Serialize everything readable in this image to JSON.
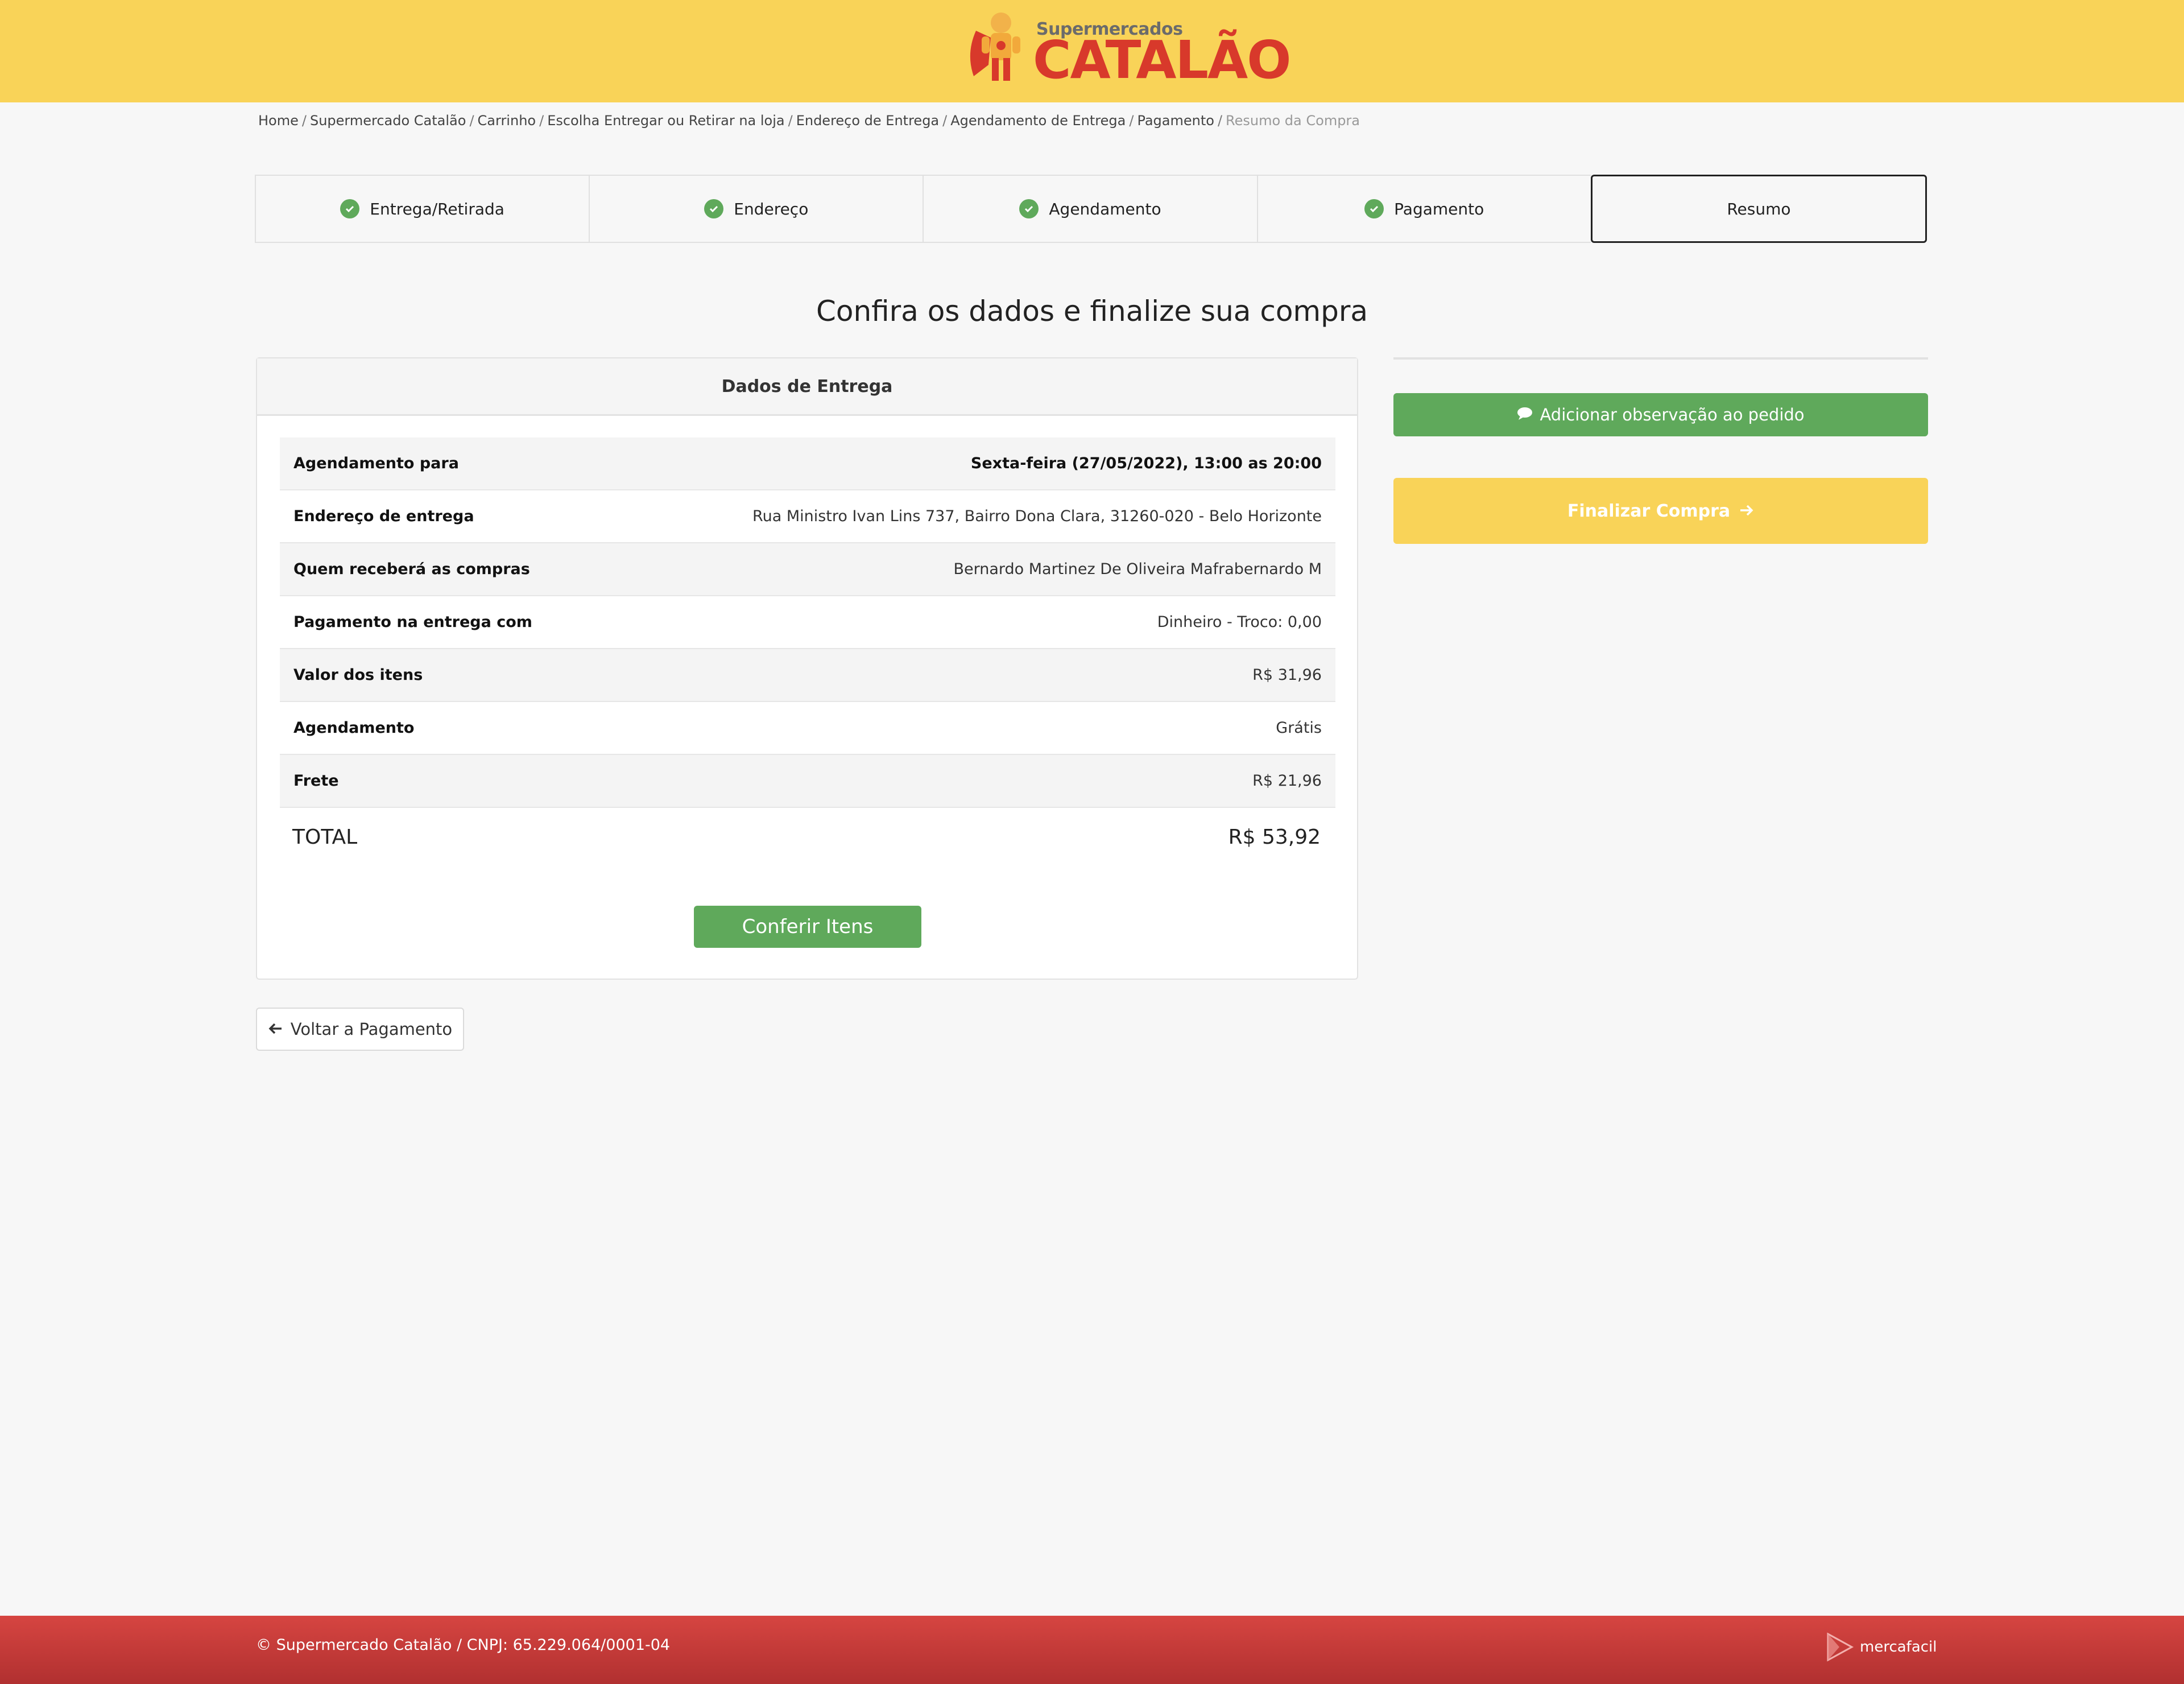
{
  "header": {
    "logo_subtitle": "Supermercados",
    "logo_title": "CATALÃO"
  },
  "breadcrumb": {
    "items": [
      "Home",
      "Supermercado Catalão",
      "Carrinho",
      "Escolha Entregar ou Retirar na loja",
      "Endereço de Entrega",
      "Agendamento de Entrega",
      "Pagamento"
    ],
    "current": "Resumo da Compra"
  },
  "steps": [
    {
      "label": "Entrega/Retirada",
      "done": true
    },
    {
      "label": "Endereço",
      "done": true
    },
    {
      "label": "Agendamento",
      "done": true
    },
    {
      "label": "Pagamento",
      "done": true
    },
    {
      "label": "Resumo",
      "done": false,
      "active": true
    }
  ],
  "page_title": "Confira os dados e finalize sua compra",
  "delivery": {
    "title": "Dados de Entrega",
    "rows": [
      {
        "label": "Agendamento para",
        "value": "Sexta-feira (27/05/2022), 13:00 as 20:00"
      },
      {
        "label": "Endereço de entrega",
        "value": "Rua Ministro Ivan Lins 737, Bairro Dona Clara, 31260-020 - Belo Horizonte"
      },
      {
        "label": "Quem receberá as compras",
        "value": "Bernardo Martinez De Oliveira Mafrabernardo M"
      },
      {
        "label": "Pagamento na entrega com",
        "value": "Dinheiro - Troco: 0,00"
      },
      {
        "label": "Valor dos itens",
        "value": "R$ 31,96"
      },
      {
        "label": "Agendamento",
        "value": "Grátis"
      },
      {
        "label": "Frete",
        "value": "R$ 21,96"
      }
    ],
    "total_label": "TOTAL",
    "total_value": "R$ 53,92",
    "check_items_label": "Conferir Itens"
  },
  "back_button": "Voltar a Pagamento",
  "sidebar": {
    "observation_button": "Adicionar observação ao pedido",
    "finish_button": "Finalizar Compra"
  },
  "footer": {
    "copyright": "© Supermercado Catalão / CNPJ: 65.229.064/0001-04",
    "brand": "mercafacil"
  },
  "colors": {
    "header_bg": "#f9d358",
    "accent_green": "#5fa95b",
    "footer_red": "#c83c38"
  },
  "icons": [
    "check-circle-icon",
    "arrow-left-icon",
    "comment-icon",
    "arrow-right-icon",
    "mercafacil-logo-icon"
  ]
}
